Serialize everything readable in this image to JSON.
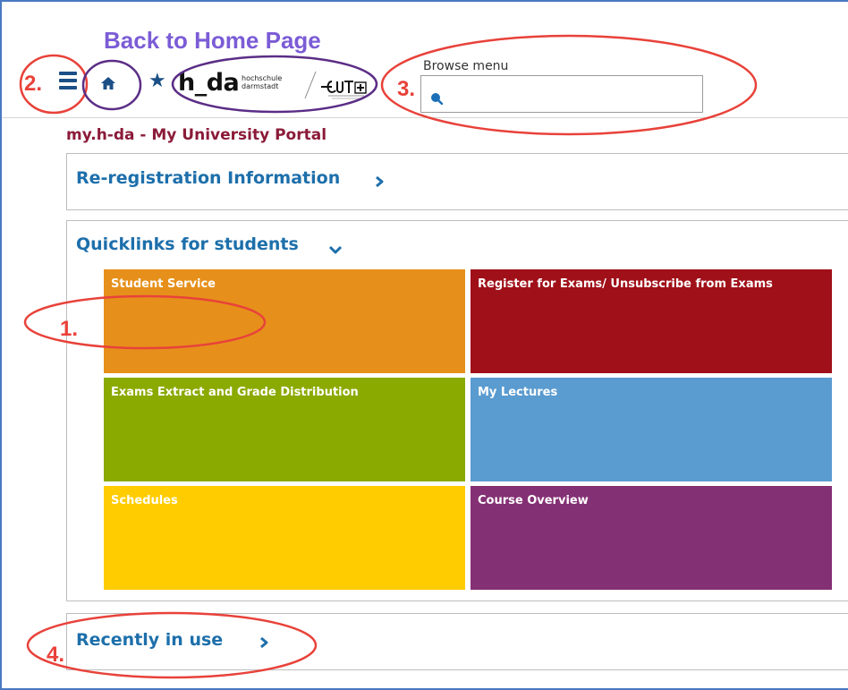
{
  "annotations": {
    "back_home": "Back to Home Page",
    "n1": "1.",
    "n2": "2.",
    "n3": "3.",
    "n4": "4.",
    "ellipse_color": "#e8423a",
    "highlight_color": "#5b2d86"
  },
  "header": {
    "logo_main": "h_da",
    "logo_sub_line1": "hochschule",
    "logo_sub_line2": "darmstadt",
    "logo_partner": "EUT+",
    "search_label": "Browse menu",
    "search_value": ""
  },
  "portal": {
    "title": "my.h-da - My University Portal"
  },
  "sections": {
    "reregistration": "Re-registration Information",
    "quicklinks": "Quicklinks for students",
    "recent": "Recently in use"
  },
  "tiles": [
    {
      "label": "Student Service",
      "color": "#e6901b"
    },
    {
      "label": "Register for Exams/ Unsubscribe from Exams",
      "color": "#a01019"
    },
    {
      "label": "Exams Extract and Grade Distribution",
      "color": "#8aaa00"
    },
    {
      "label": "My Lectures",
      "color": "#5a9bd0"
    },
    {
      "label": "Schedules",
      "color": "#ffcc00"
    },
    {
      "label": "Course Overview",
      "color": "#843074"
    }
  ],
  "icons": {
    "menu": "hamburger-icon",
    "home": "home-icon",
    "favorite": "star-icon",
    "search": "search-icon",
    "expand": "chevron-right-icon",
    "collapse": "chevron-down-icon"
  }
}
